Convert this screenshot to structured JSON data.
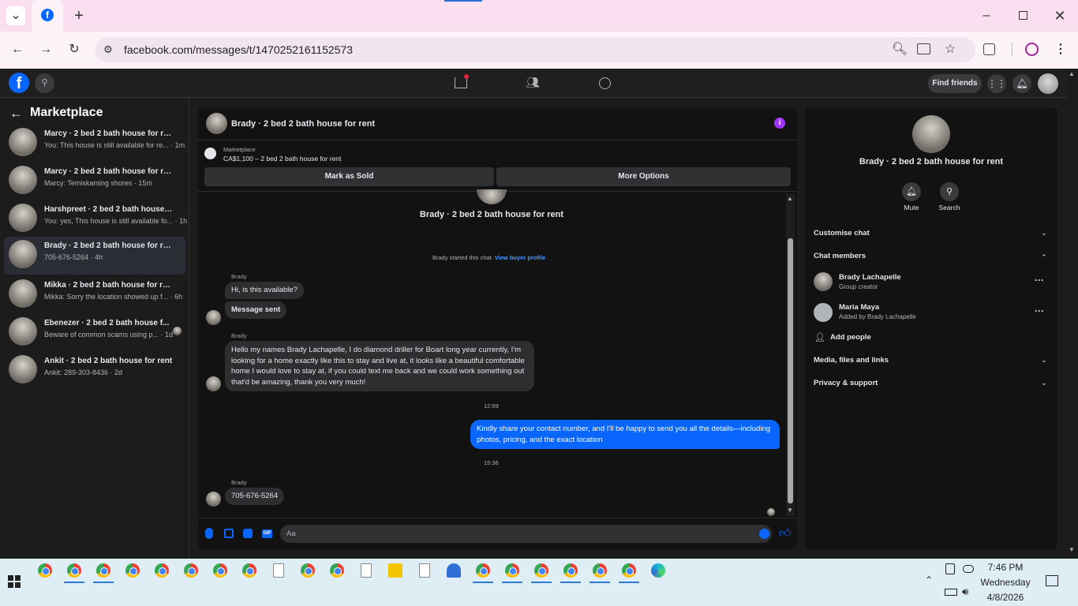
{
  "browser": {
    "url": "facebook.com/messages/t/1470252161152573",
    "new_tab_symbol": "+",
    "window_controls": [
      "minimize",
      "restore",
      "close"
    ]
  },
  "fb_nav": {
    "logo": "f",
    "find_friends": "Find friends"
  },
  "sidebar": {
    "title": "Marketplace",
    "chats": [
      {
        "title": "Marcy · 2 bed 2 bath house for rent",
        "snippet": "You: This house is still available for re... · 1m",
        "selected": false
      },
      {
        "title": "Marcy · 2 bed 2 bath house for rent",
        "snippet": "Marcy: Temiskaming shores · 15m",
        "selected": false
      },
      {
        "title": "Harshpreet · 2 bed 2 bath house f...",
        "snippet": "You: yes, This house is still available fo... · 1h",
        "selected": false
      },
      {
        "title": "Brady · 2 bed 2 bath house for rent",
        "snippet": "705-676-5264 · 4h",
        "selected": true
      },
      {
        "title": "Mikka · 2 bed 2 bath house for rent",
        "snippet": "Mikka: Sorry the location showed up f... · 6h",
        "selected": false
      },
      {
        "title": "Ebenezer · 2 bed 2 bath house f...",
        "snippet": "Beware of common scams using p... · 1d",
        "selected": false
      },
      {
        "title": "Ankit · 2 bed 2 bath house for rent",
        "snippet": "Ankit: 289-303-8436 · 2d",
        "selected": false
      }
    ]
  },
  "chat": {
    "header_title": "Brady · 2 bed 2 bath house for rent",
    "marketplace_label": "Marketplace",
    "listing": "CA$1,100 – 2 bed 2 bath house for rent",
    "mark_sold": "Mark as Sold",
    "more_options": "More Options",
    "center_title": "Brady · 2 bed 2 bath house for rent",
    "started_text": "Brady started this chat.",
    "view_profile": "View buyer profile",
    "sender_name": "Brady",
    "messages": {
      "m1": "Hi, is this available?",
      "m2": "Message sent",
      "m3": "Hello my names Brady Lachapelle, I do diamond driller for Boart long year currently, I'm looking for a home exactly like this to stay and live at, it looks like a beautiful comfortable home I would love to stay at, if you could text me back and we could work something out that'd be amazing, thank you very much!",
      "time1": "12:59",
      "m4": "Kindly share your contact number, and I'll be happy to send you all the details—including photos, pricing, and the exact location",
      "time2": "15:36",
      "m5": "705-676-5264"
    },
    "composer_placeholder": "Aa"
  },
  "info_panel": {
    "title": "Brady · 2 bed 2 bath house for rent",
    "mute": "Mute",
    "search": "Search",
    "customise": "Customise chat",
    "members_heading": "Chat members",
    "members": [
      {
        "name": "Brady Lachapelle",
        "role": "Group creator"
      },
      {
        "name": "Maria Maya",
        "role": "Added by Brady Lachapelle"
      }
    ],
    "add_people": "Add people",
    "media": "Media, files and links",
    "privacy": "Privacy & support"
  },
  "taskbar": {
    "time": "7:46 PM",
    "day": "Wednesday",
    "date": "4/8/2026"
  },
  "colors": {
    "accent": "#0866ff",
    "bubble_other": "#2d2e30",
    "info_icon": "#a033ff"
  }
}
